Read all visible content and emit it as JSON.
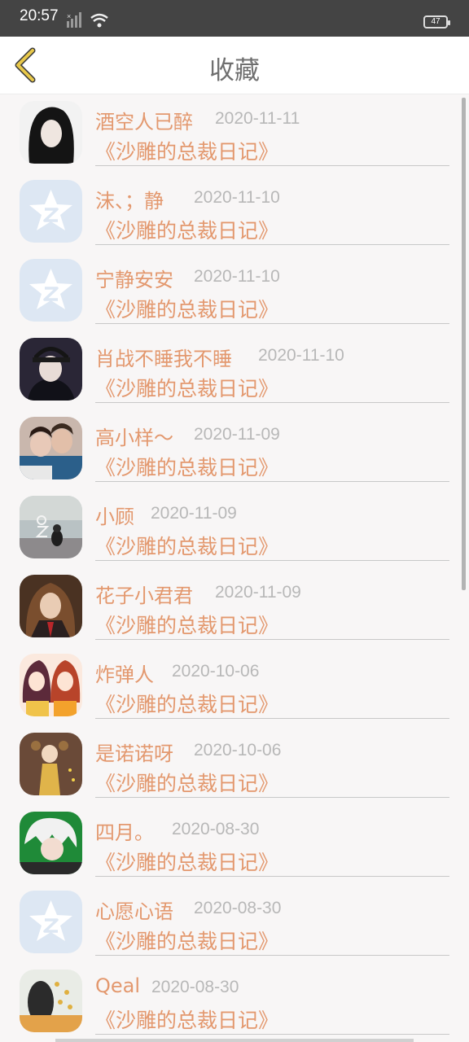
{
  "status_bar": {
    "time": "20:57",
    "battery": "47"
  },
  "header": {
    "title": "收藏"
  },
  "items": [
    {
      "name": "酒空人已醉",
      "date": "2020-11-11",
      "book": "《沙雕的总裁日记》",
      "avatar": "photo-dark"
    },
    {
      "name": "沫、；静",
      "date": "2020-11-10",
      "book": "《沙雕的总裁日记》",
      "avatar": "qzone-default"
    },
    {
      "name": "宁静安安",
      "date": "2020-11-10",
      "book": "《沙雕的总裁日记》",
      "avatar": "qzone-default"
    },
    {
      "name": "肖战不睡我不睡",
      "date": "2020-11-10",
      "book": "《沙雕的总裁日记》",
      "avatar": "photo-cap"
    },
    {
      "name": "高小样～",
      "date": "2020-11-09",
      "book": "《沙雕的总裁日记》",
      "avatar": "photo-couple"
    },
    {
      "name": "小顾",
      "date": "2020-11-09",
      "book": "《沙雕的总裁日记》",
      "avatar": "photo-neon"
    },
    {
      "name": "花子小君君",
      "date": "2020-11-09",
      "book": "《沙雕的总裁日记》",
      "avatar": "photo-wizard"
    },
    {
      "name": "炸弹人",
      "date": "2020-10-06",
      "book": "《沙雕的总裁日记》",
      "avatar": "anime-girls"
    },
    {
      "name": "是诺诺呀",
      "date": "2020-10-06",
      "book": "《沙雕的总裁日记》",
      "avatar": "anime-yellow"
    },
    {
      "name": "四月。",
      "date": "2020-08-30",
      "book": "《沙雕的总裁日记》",
      "avatar": "anime-green"
    },
    {
      "name": "心愿心语",
      "date": "2020-08-30",
      "book": "《沙雕的总裁日记》",
      "avatar": "qzone-default"
    },
    {
      "name": "Qeal",
      "date": "2020-08-30",
      "book": "《沙雕的总裁日记》",
      "avatar": "photo-flowers"
    }
  ],
  "colors": {
    "accent": "#e3986e",
    "date": "#b8b8b8",
    "title": "#6f6f6f",
    "back_icon": "#e8c84a"
  }
}
